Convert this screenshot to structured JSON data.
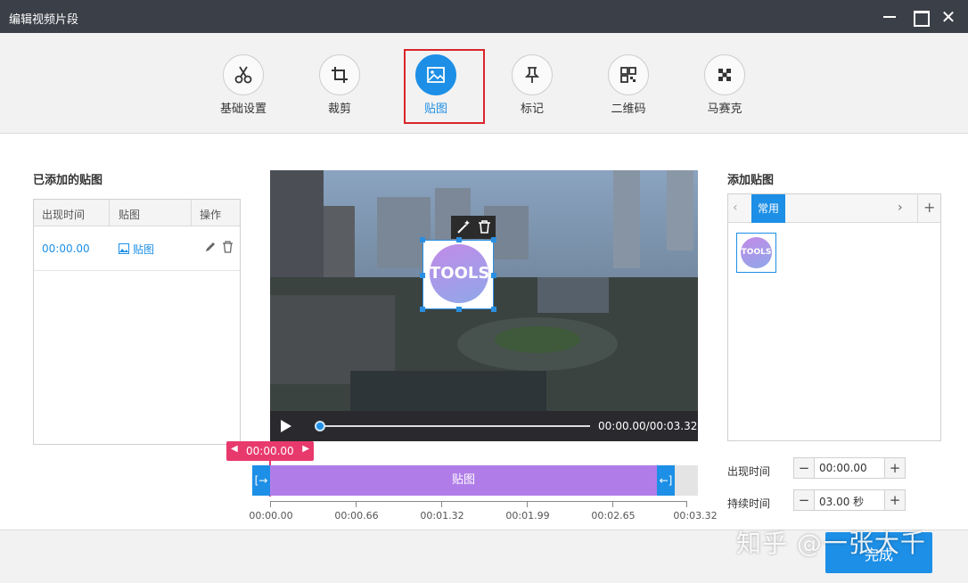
{
  "window": {
    "title": "编辑视频片段"
  },
  "toolbar": {
    "items": [
      {
        "label": "基础设置",
        "icon": "scissors-icon"
      },
      {
        "label": "裁剪",
        "icon": "crop-icon"
      },
      {
        "label": "贴图",
        "icon": "image-icon",
        "active": true
      },
      {
        "label": "标记",
        "icon": "pin-icon"
      },
      {
        "label": "二维码",
        "icon": "qrcode-icon"
      },
      {
        "label": "马赛克",
        "icon": "mosaic-icon"
      }
    ]
  },
  "added_stickers": {
    "title": "已添加的贴图",
    "columns": [
      "出现时间",
      "贴图",
      "操作"
    ],
    "rows": [
      {
        "time": "00:00.00",
        "sticker": "贴图"
      }
    ]
  },
  "preview": {
    "time_display": "00:00.00/00:03.32",
    "progress": 0,
    "sticker_text": "TOOLS"
  },
  "timeline": {
    "marker": "00:00.00",
    "clip_label": "贴图",
    "ticks": [
      "00:00.00",
      "00:00.66",
      "00:01.32",
      "00:01.99",
      "00:02.65",
      "00:03.32"
    ]
  },
  "add_sticker": {
    "title": "添加贴图",
    "tabs": [
      "常用"
    ],
    "thumb_text": "TOOLS"
  },
  "appear_time": {
    "label": "出现时间",
    "value": "00:00.00"
  },
  "duration": {
    "label": "持续时间",
    "value": "03.00 秒"
  },
  "footer": {
    "done_label": "完成"
  },
  "watermark": "知乎 @一张大千",
  "colors": {
    "accent": "#1d8fe6",
    "clip": "#b07de8",
    "marker": "#e8396d",
    "highlight": "#d9262b"
  }
}
